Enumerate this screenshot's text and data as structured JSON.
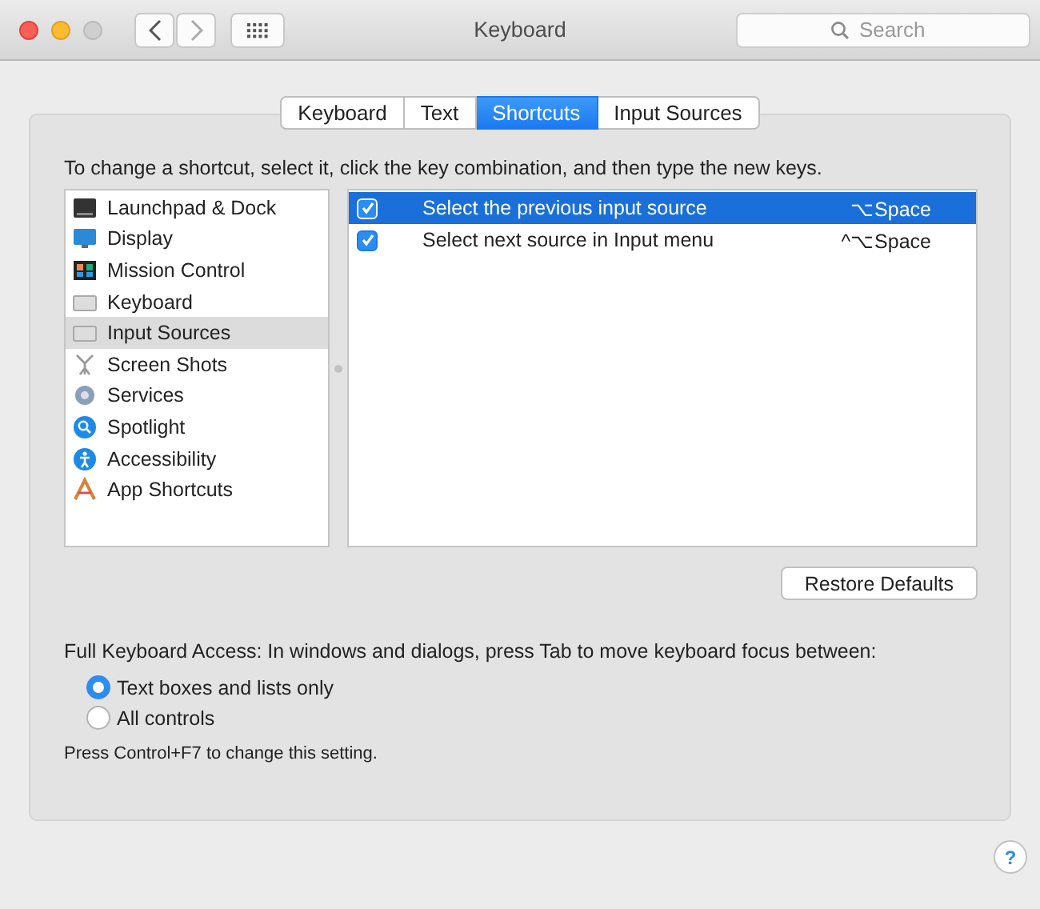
{
  "window": {
    "title": "Keyboard"
  },
  "search": {
    "placeholder": "Search"
  },
  "tabs": [
    {
      "label": "Keyboard",
      "selected": false
    },
    {
      "label": "Text",
      "selected": false
    },
    {
      "label": "Shortcuts",
      "selected": true
    },
    {
      "label": "Input Sources",
      "selected": false
    }
  ],
  "instructions": "To change a shortcut, select it, click the key combination, and then type the new keys.",
  "categories": [
    {
      "label": "Launchpad & Dock",
      "selected": false
    },
    {
      "label": "Display",
      "selected": false
    },
    {
      "label": "Mission Control",
      "selected": false
    },
    {
      "label": "Keyboard",
      "selected": false
    },
    {
      "label": "Input Sources",
      "selected": true
    },
    {
      "label": "Screen Shots",
      "selected": false
    },
    {
      "label": "Services",
      "selected": false
    },
    {
      "label": "Spotlight",
      "selected": false
    },
    {
      "label": "Accessibility",
      "selected": false
    },
    {
      "label": "App Shortcuts",
      "selected": false
    }
  ],
  "shortcuts": [
    {
      "checked": true,
      "selected": true,
      "name": "Select the previous input source",
      "keys": "⌥Space"
    },
    {
      "checked": true,
      "selected": false,
      "name": "Select next source in Input menu",
      "keys": "^⌥Space"
    }
  ],
  "restore_button": "Restore Defaults",
  "full_keyboard_access": {
    "label": "Full Keyboard Access: In windows and dialogs, press Tab to move keyboard focus between:",
    "options": [
      {
        "label": "Text boxes and lists only",
        "selected": true
      },
      {
        "label": "All controls",
        "selected": false
      }
    ],
    "note": "Press Control+F7 to change this setting."
  },
  "help_button": "?"
}
